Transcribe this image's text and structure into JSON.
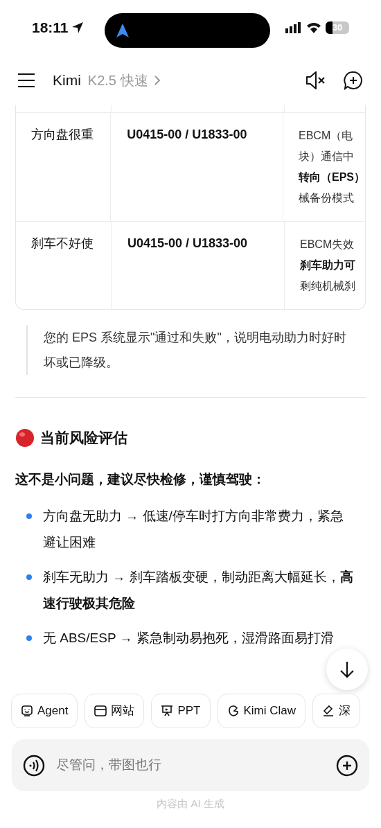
{
  "status_bar": {
    "time": "18:11",
    "battery": "30"
  },
  "nav": {
    "title": "Kimi",
    "model": "K2.5 快速"
  },
  "table": {
    "rows": [
      {
        "symptom": "方向盘很重",
        "code": "U0415-00 / U1833-00",
        "cause": [
          {
            "text": "EBCM（电",
            "bold": false
          },
          {
            "text": "块）通信中",
            "bold": false
          },
          {
            "text": "转向（EPS）",
            "bold": true
          },
          {
            "text": "械备份模式",
            "bold": false
          }
        ]
      },
      {
        "symptom": "刹车不好使",
        "code": "U0415-00 / U1833-00",
        "cause": [
          {
            "text": "EBCM失效",
            "bold": false
          },
          {
            "text": "刹车助力可",
            "bold": true
          },
          {
            "text": "剩纯机械刹",
            "bold": false
          }
        ]
      }
    ]
  },
  "quote": "您的 EPS 系统显示\"通过和失败\"，说明电动助力时好时坏或已降级。",
  "heading": "当前风险评估",
  "lead": "这不是小问题，建议尽快检修，谨慎驾驶：",
  "bullets": [
    "方向盘无助力 → 低速/停车时打方向非常费力，紧急避让困难",
    "刹车无助力 → 刹车踏板变硬，制动距离大幅延长，**高速行驶极其危险**",
    "无 ABS/ESP → 紧急制动易抱死，湿滑路面易打滑"
  ],
  "chips": [
    {
      "label": "Agent"
    },
    {
      "label": "网站"
    },
    {
      "label": "PPT"
    },
    {
      "label": "Kimi Claw"
    },
    {
      "label": "深"
    }
  ],
  "input": {
    "placeholder": "尽管问，带图也行"
  },
  "footer": "内容由 AI 生成"
}
